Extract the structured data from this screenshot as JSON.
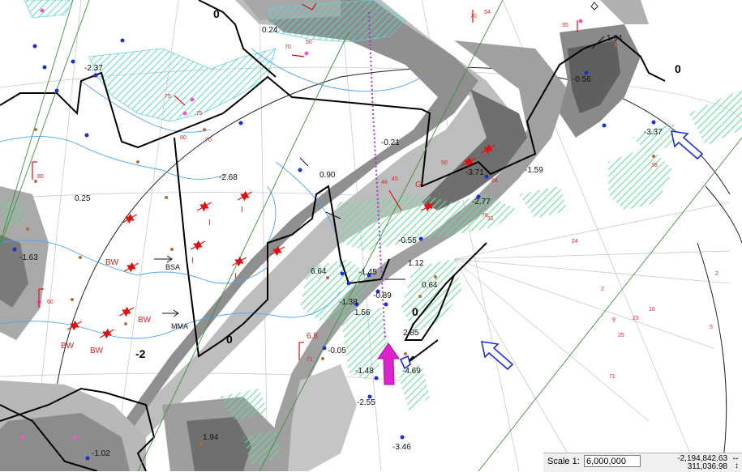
{
  "map": {
    "contour_labels": {
      "zero": "0",
      "neg_two": "-2"
    },
    "station_values": [
      "0.24",
      "-2.37",
      "-0.56",
      "-3.37",
      "-0.21",
      "0.90",
      "-2.68",
      "0.25",
      "-3.71",
      "-1.59",
      "-2.77",
      "-0.55",
      "1.12",
      "-1.45",
      "6.64",
      "-1.63",
      "0.64",
      "-0.89",
      "-1.38",
      "1.56",
      "2.85",
      "-0.05",
      "-1.48",
      "-4.69",
      "-2.55",
      "-3.46",
      "-1.02",
      "1.94",
      "1.94"
    ],
    "front_labels": {
      "bw": "BW",
      "i": "I",
      "g": "G",
      "bsa": "BSA",
      "mma": "MMA"
    },
    "red_numbers": [
      "70",
      "54",
      "35",
      "50",
      "70",
      "75",
      "75",
      "80",
      "70",
      "80",
      "48",
      "45",
      "50",
      "64",
      "31",
      "24",
      "2",
      "9",
      "23",
      "16",
      "25",
      "5",
      "71",
      "71",
      "60",
      "36",
      "78",
      "2",
      "6.8"
    ],
    "colors": {
      "ice_hatch": "#5fd6d0",
      "green_hatch": "#66dd99",
      "terrain_dark": "#7c7c7c",
      "terrain_mid": "#a8a8a8",
      "terrain_light": "#cfcfcf",
      "contour": "#000000",
      "river": "#4da3ff",
      "station": "#1a2fd8",
      "station_alt": "#b07040",
      "front": "#e01010",
      "track": "#aa33cc",
      "arrow_magenta": "#dd22cc",
      "arrow_blue": "#1a2fd8"
    }
  },
  "statusbar": {
    "scale_label": "Scale 1:",
    "scale_value": "6,000,000",
    "coord_x": "-2,194,842.63",
    "coord_y": "311,036.98",
    "icon_h": "↔",
    "icon_v": "↕"
  }
}
